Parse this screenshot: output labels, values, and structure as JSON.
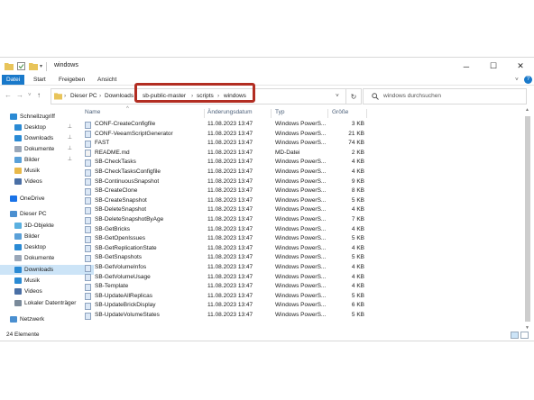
{
  "window": {
    "title": "windows",
    "controls": {
      "minimize": "─",
      "maximize": "☐",
      "close": "✕"
    }
  },
  "ribbon": {
    "tabs": [
      "Datei",
      "Start",
      "Freigeben",
      "Ansicht"
    ],
    "active_tab": "Datei",
    "collapse_glyph": "˅",
    "help_glyph": "?"
  },
  "address": {
    "back": "←",
    "forward": "→",
    "recent": "˅",
    "up": "↑",
    "crumbs": [
      "Dieser PC",
      "Downloads",
      "sb-public-master",
      "scripts",
      "windows"
    ],
    "separator": "›",
    "dropdown": "˅",
    "refresh": "↻",
    "search_placeholder": "windows durchsuchen"
  },
  "nav": {
    "items": [
      {
        "label": "Schnellzugriff",
        "icon": "star-icon",
        "color": "#2a8ad4",
        "pinned": false,
        "selected": false
      },
      {
        "label": "Desktop",
        "icon": "desktop-icon",
        "color": "#2a8ad4",
        "pinned": true,
        "selected": false
      },
      {
        "label": "Downloads",
        "icon": "download-icon",
        "color": "#2a8ad4",
        "pinned": true,
        "selected": false
      },
      {
        "label": "Dokumente",
        "icon": "documents-icon",
        "color": "#9aa7b8",
        "pinned": true,
        "selected": false
      },
      {
        "label": "Bilder",
        "icon": "pictures-icon",
        "color": "#5aa0d8",
        "pinned": true,
        "selected": false
      },
      {
        "label": "Musik",
        "icon": "music-icon",
        "color": "#e8b84a",
        "pinned": false,
        "selected": false
      },
      {
        "label": "Videos",
        "icon": "videos-icon",
        "color": "#4a6fa5",
        "pinned": false,
        "selected": false
      },
      {
        "label": "OneDrive",
        "icon": "onedrive-icon",
        "color": "#1a73e8",
        "pinned": false,
        "selected": false
      },
      {
        "label": "Dieser PC",
        "icon": "computer-icon",
        "color": "#4a8fd0",
        "pinned": false,
        "selected": false
      },
      {
        "label": "3D-Objekte",
        "icon": "3d-objects-icon",
        "color": "#5ab0e0",
        "pinned": false,
        "selected": false
      },
      {
        "label": "Bilder",
        "icon": "pictures-icon",
        "color": "#5aa0d8",
        "pinned": false,
        "selected": false
      },
      {
        "label": "Desktop",
        "icon": "desktop-icon",
        "color": "#2a8ad4",
        "pinned": false,
        "selected": false
      },
      {
        "label": "Dokumente",
        "icon": "documents-icon",
        "color": "#9aa7b8",
        "pinned": false,
        "selected": false
      },
      {
        "label": "Downloads",
        "icon": "download-icon",
        "color": "#2a8ad4",
        "pinned": false,
        "selected": true
      },
      {
        "label": "Musik",
        "icon": "music-icon",
        "color": "#2a8ad4",
        "pinned": false,
        "selected": false
      },
      {
        "label": "Videos",
        "icon": "videos-icon",
        "color": "#4a6fa5",
        "pinned": false,
        "selected": false
      },
      {
        "label": "Lokaler Datenträger",
        "icon": "drive-icon",
        "color": "#7a8a9a",
        "pinned": false,
        "selected": false
      },
      {
        "label": "Netzwerk",
        "icon": "network-icon",
        "color": "#4a8fd0",
        "pinned": false,
        "selected": false
      }
    ],
    "pin_glyph": "📌"
  },
  "list": {
    "columns": [
      "Name",
      "Änderungsdatum",
      "Typ",
      "Größe"
    ],
    "sort_glyph": "^",
    "rows": [
      {
        "name": "CONF-CreateConfigfile",
        "date": "11.08.2023 13:47",
        "type": "Windows PowerS...",
        "size": "3 KB",
        "icon": "powershell-file-icon"
      },
      {
        "name": "CONF-VeeamScriptGenerator",
        "date": "11.08.2023 13:47",
        "type": "Windows PowerS...",
        "size": "21 KB",
        "icon": "powershell-file-icon"
      },
      {
        "name": "FAST",
        "date": "11.08.2023 13:47",
        "type": "Windows PowerS...",
        "size": "74 KB",
        "icon": "powershell-file-icon"
      },
      {
        "name": "README.md",
        "date": "11.08.2023 13:47",
        "type": "MD-Datei",
        "size": "2 KB",
        "icon": "text-file-icon"
      },
      {
        "name": "SB-CheckTasks",
        "date": "11.08.2023 13:47",
        "type": "Windows PowerS...",
        "size": "4 KB",
        "icon": "powershell-file-icon"
      },
      {
        "name": "SB-CheckTasksConfigfile",
        "date": "11.08.2023 13:47",
        "type": "Windows PowerS...",
        "size": "4 KB",
        "icon": "powershell-file-icon"
      },
      {
        "name": "SB-ContinuousSnapshot",
        "date": "11.08.2023 13:47",
        "type": "Windows PowerS...",
        "size": "9 KB",
        "icon": "powershell-file-icon"
      },
      {
        "name": "SB-CreateClone",
        "date": "11.08.2023 13:47",
        "type": "Windows PowerS...",
        "size": "8 KB",
        "icon": "powershell-file-icon"
      },
      {
        "name": "SB-CreateSnapshot",
        "date": "11.08.2023 13:47",
        "type": "Windows PowerS...",
        "size": "5 KB",
        "icon": "powershell-file-icon"
      },
      {
        "name": "SB-DeleteSnapshot",
        "date": "11.08.2023 13:47",
        "type": "Windows PowerS...",
        "size": "4 KB",
        "icon": "powershell-file-icon"
      },
      {
        "name": "SB-DeleteSnapshotByAge",
        "date": "11.08.2023 13:47",
        "type": "Windows PowerS...",
        "size": "7 KB",
        "icon": "powershell-file-icon"
      },
      {
        "name": "SB-GetBricks",
        "date": "11.08.2023 13:47",
        "type": "Windows PowerS...",
        "size": "4 KB",
        "icon": "powershell-file-icon"
      },
      {
        "name": "SB-GetOpenIssues",
        "date": "11.08.2023 13:47",
        "type": "Windows PowerS...",
        "size": "5 KB",
        "icon": "powershell-file-icon"
      },
      {
        "name": "SB-GetReplicationState",
        "date": "11.08.2023 13:47",
        "type": "Windows PowerS...",
        "size": "4 KB",
        "icon": "powershell-file-icon"
      },
      {
        "name": "SB-GetSnapshots",
        "date": "11.08.2023 13:47",
        "type": "Windows PowerS...",
        "size": "5 KB",
        "icon": "powershell-file-icon"
      },
      {
        "name": "SB-GetVolumeInfos",
        "date": "11.08.2023 13:47",
        "type": "Windows PowerS...",
        "size": "4 KB",
        "icon": "powershell-file-icon"
      },
      {
        "name": "SB-GetVolumeUsage",
        "date": "11.08.2023 13:47",
        "type": "Windows PowerS...",
        "size": "4 KB",
        "icon": "powershell-file-icon"
      },
      {
        "name": "SB-Template",
        "date": "11.08.2023 13:47",
        "type": "Windows PowerS...",
        "size": "4 KB",
        "icon": "powershell-file-icon"
      },
      {
        "name": "SB-UpdateAllReplicas",
        "date": "11.08.2023 13:47",
        "type": "Windows PowerS...",
        "size": "5 KB",
        "icon": "powershell-file-icon"
      },
      {
        "name": "SB-UpdateBrickDisplay",
        "date": "11.08.2023 13:47",
        "type": "Windows PowerS...",
        "size": "6 KB",
        "icon": "powershell-file-icon"
      },
      {
        "name": "SB-UpdateVolumeStates",
        "date": "11.08.2023 13:47",
        "type": "Windows PowerS...",
        "size": "5 KB",
        "icon": "powershell-file-icon"
      }
    ]
  },
  "status": {
    "count_text": "24 Elemente"
  },
  "colors": {
    "accent": "#1979ca",
    "highlight_box": "#b22d22",
    "selection": "#cce4f7",
    "header_text": "#4c607a"
  }
}
